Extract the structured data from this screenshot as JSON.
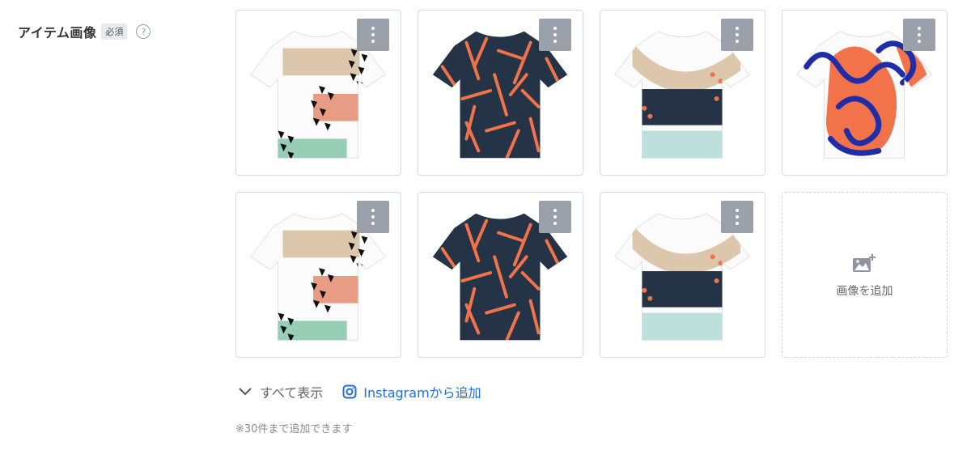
{
  "field": {
    "label": "アイテム画像",
    "required_badge": "必須",
    "help_icon": "question-circle-icon",
    "help_glyph": "?"
  },
  "images": [
    {
      "pattern": "pastel-stripes-dots",
      "menu_icon": "kebab-menu-icon"
    },
    {
      "pattern": "orange-sticks-navy",
      "menu_icon": "kebab-menu-icon"
    },
    {
      "pattern": "beige-navy-brush",
      "menu_icon": "kebab-menu-icon"
    },
    {
      "pattern": "blue-orange-swirls",
      "menu_icon": "kebab-menu-icon"
    },
    {
      "pattern": "pastel-stripes-dots",
      "menu_icon": "kebab-menu-icon"
    },
    {
      "pattern": "orange-sticks-navy",
      "menu_icon": "kebab-menu-icon"
    },
    {
      "pattern": "beige-navy-brush",
      "menu_icon": "kebab-menu-icon"
    }
  ],
  "add_image": {
    "label": "画像を追加",
    "icon": "add-image-icon"
  },
  "actions": {
    "show_all_label": "すべて表示",
    "show_all_icon": "chevron-down-icon",
    "instagram_label": "Instagramから追加",
    "instagram_icon": "instagram-icon"
  },
  "note": "※30件まで追加できます",
  "colors": {
    "navy": "#243446",
    "orange": "#f2724a",
    "beige": "#dcc7ad",
    "salmon": "#e99c84",
    "mint": "#98cdb6",
    "royal_blue": "#1f2ea8",
    "light_teal": "#bde0dd",
    "link_blue": "#1f6fd6",
    "menu_gray": "#9aa1ab"
  }
}
